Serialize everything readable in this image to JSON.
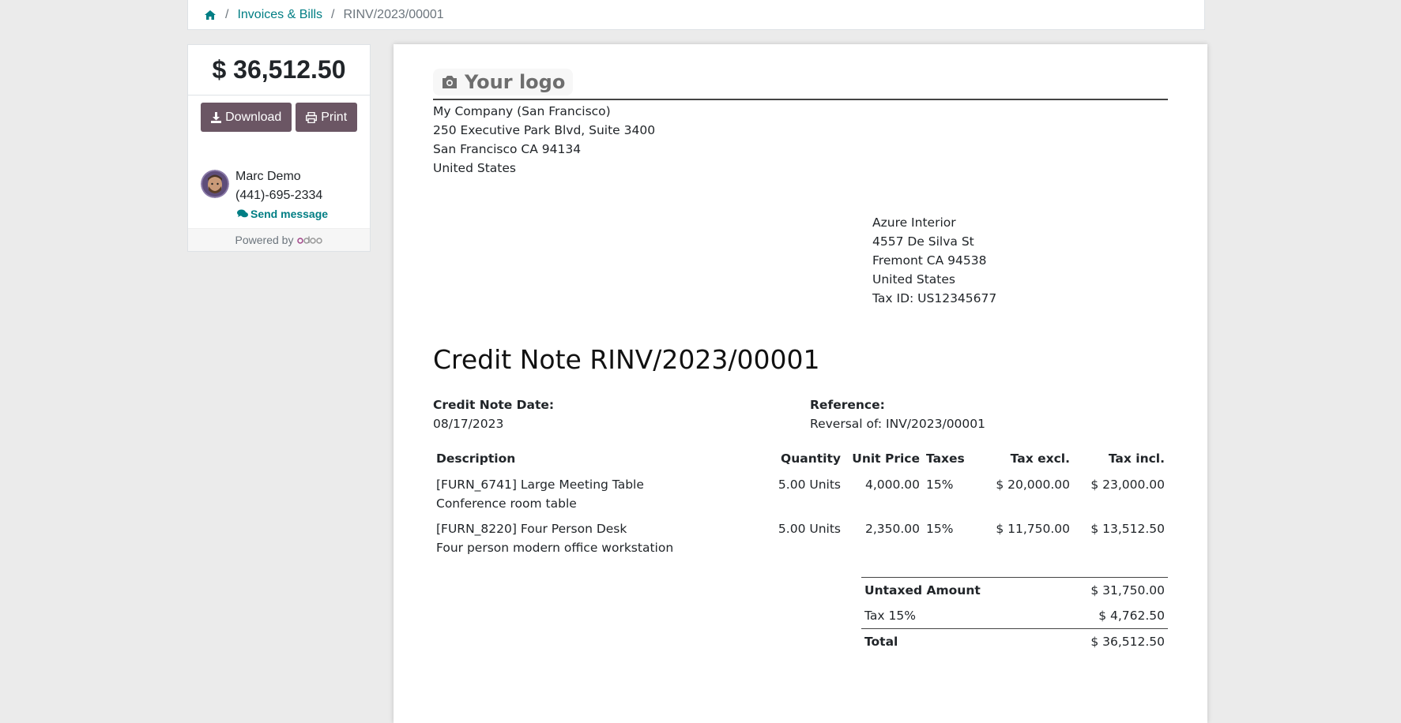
{
  "breadcrumb": {
    "home_icon": "home-icon",
    "items": [
      "Invoices & Bills",
      "RINV/2023/00001"
    ]
  },
  "sidebar": {
    "amount": "$ 36,512.50",
    "download_label": "Download",
    "print_label": "Print",
    "contact": {
      "name": "Marc Demo",
      "phone": "(441)-695-2334",
      "send_message": "Send message"
    },
    "powered_by": "Powered by"
  },
  "document": {
    "logo_text": "Your logo",
    "company_address": [
      "My Company (San Francisco)",
      "250 Executive Park Blvd, Suite 3400",
      "San Francisco CA 94134",
      "United States"
    ],
    "partner_address": [
      "Azure Interior",
      "4557 De Silva St",
      "Fremont CA 94538",
      "United States",
      "Tax ID: US12345677"
    ],
    "title": "Credit Note RINV/2023/00001",
    "date_label": "Credit Note Date:",
    "date_value": "08/17/2023",
    "reference_label": "Reference:",
    "reference_value": "Reversal of: INV/2023/00001",
    "columns": [
      "Description",
      "Quantity",
      "Unit Price",
      "Taxes",
      "Tax excl.",
      "Tax incl."
    ],
    "lines": [
      {
        "desc1": "[FURN_6741] Large Meeting Table",
        "desc2": "Conference room table",
        "quantity": "5.00 Units",
        "unit_price": "4,000.00",
        "taxes": "15%",
        "tax_excl": "$ 20,000.00",
        "tax_incl": "$ 23,000.00"
      },
      {
        "desc1": "[FURN_8220] Four Person Desk",
        "desc2": "Four person modern office workstation",
        "quantity": "5.00 Units",
        "unit_price": "2,350.00",
        "taxes": "15%",
        "tax_excl": "$ 11,750.00",
        "tax_incl": "$ 13,512.50"
      }
    ],
    "totals": {
      "untaxed_label": "Untaxed Amount",
      "untaxed_value": "$ 31,750.00",
      "tax_label": "Tax 15%",
      "tax_value": "$ 4,762.50",
      "total_label": "Total",
      "total_value": "$ 36,512.50"
    }
  },
  "colors": {
    "accent_link": "#017e84",
    "button": "#6b5664",
    "background": "#ebebeb"
  }
}
